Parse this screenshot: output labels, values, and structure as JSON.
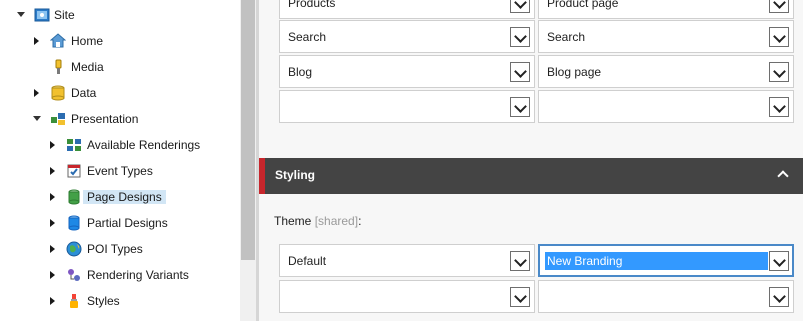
{
  "tree": {
    "root": {
      "label": "Site",
      "icon": "site-icon"
    },
    "items": [
      {
        "label": "Home",
        "icon": "home-icon"
      },
      {
        "label": "Media",
        "icon": "media-icon"
      },
      {
        "label": "Data",
        "icon": "data-icon"
      },
      {
        "label": "Presentation",
        "icon": "presentation-icon"
      }
    ],
    "presentation_children": [
      {
        "label": "Available Renderings",
        "icon": "renderings-icon"
      },
      {
        "label": "Event Types",
        "icon": "event-types-icon"
      },
      {
        "label": "Page Designs",
        "icon": "page-designs-icon"
      },
      {
        "label": "Partial Designs",
        "icon": "partial-designs-icon"
      },
      {
        "label": "POI Types",
        "icon": "globe-icon"
      },
      {
        "label": "Rendering Variants",
        "icon": "variants-icon"
      },
      {
        "label": "Styles",
        "icon": "styles-icon"
      }
    ]
  },
  "mapping": {
    "rows": [
      {
        "left": "Products",
        "right": "Product page"
      },
      {
        "left": "Search",
        "right": "Search"
      },
      {
        "left": "Blog",
        "right": "Blog page"
      },
      {
        "left": "",
        "right": ""
      }
    ]
  },
  "styling": {
    "title": "Styling",
    "theme_label": "Theme",
    "shared_tag": "[shared]",
    "colon": ":",
    "rows": [
      {
        "left": "Default",
        "right": "New Branding"
      },
      {
        "left": "",
        "right": ""
      }
    ]
  },
  "colors": {
    "section_bg": "#444444",
    "accent": "#c7262c",
    "selection": "#3399ff",
    "tree_selected": "#d2e6f5"
  }
}
